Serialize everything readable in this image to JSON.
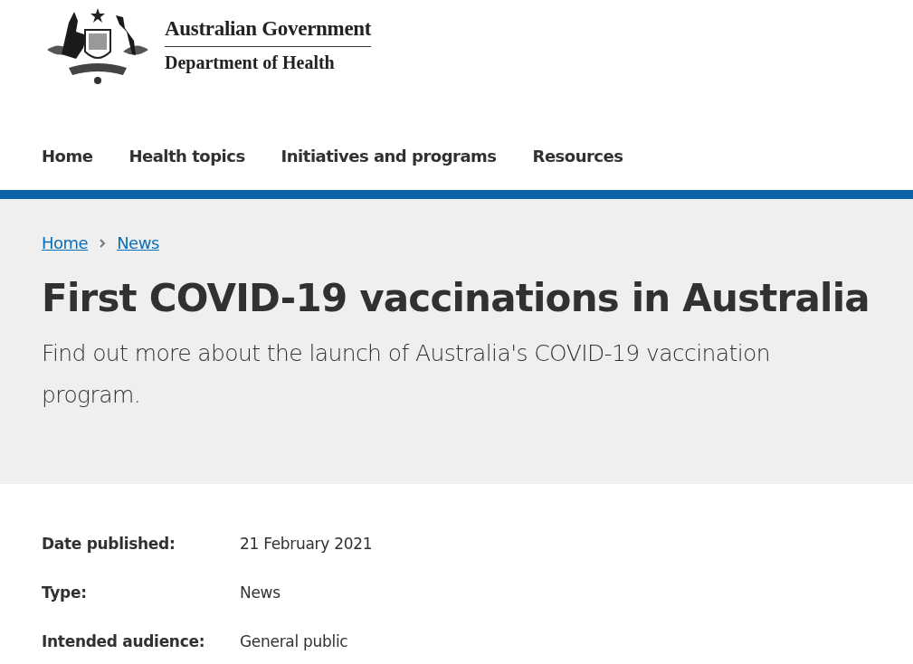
{
  "header": {
    "government": "Australian Government",
    "department": "Department of Health"
  },
  "nav": [
    {
      "label": "Home"
    },
    {
      "label": "Health topics"
    },
    {
      "label": "Initiatives and programs"
    },
    {
      "label": "Resources"
    }
  ],
  "breadcrumb": [
    {
      "label": "Home"
    },
    {
      "label": "News"
    }
  ],
  "hero": {
    "title": "First COVID-19 vaccinations in Australia",
    "summary": "Find out more about the launch of Australia's COVID-19 vaccination program."
  },
  "meta": [
    {
      "label": "Date published:",
      "value": "21 February 2021"
    },
    {
      "label": "Type:",
      "value": "News"
    },
    {
      "label": "Intended audience:",
      "value": "General public"
    }
  ]
}
